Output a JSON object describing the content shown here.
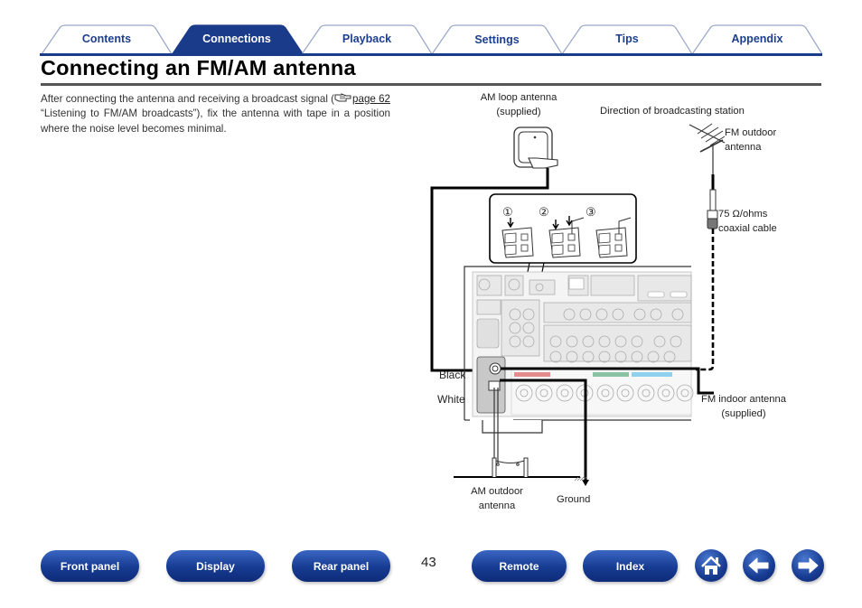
{
  "tabs": [
    {
      "label": "Contents",
      "active": false
    },
    {
      "label": "Connections",
      "active": true
    },
    {
      "label": "Playback",
      "active": false
    },
    {
      "label": "Settings",
      "active": false
    },
    {
      "label": "Tips",
      "active": false
    },
    {
      "label": "Appendix",
      "active": false
    }
  ],
  "page": {
    "title": "Connecting an FM/AM antenna",
    "body_before": "After connecting the antenna and receiving a broadcast signal (",
    "ref_icon": "pointing-hand-reference-icon",
    "ref_link": "page 62",
    "body_after": " “Listening to FM/AM broadcasts”), fix the antenna with tape in a position where the noise level becomes minimal.",
    "page_number": "43"
  },
  "diagram": {
    "am_loop_line1": "AM loop antenna",
    "am_loop_line2": "(supplied)",
    "direction": "Direction of broadcasting station",
    "fm_outdoor_line1": "FM outdoor",
    "fm_outdoor_line2": "antenna",
    "coax_line1": "75 Ω/ohms",
    "coax_line2": "coaxial cable",
    "step1": "①",
    "step2": "②",
    "step3": "③",
    "black": "Black",
    "white": "White",
    "fm_indoor_line1": "FM indoor antenna",
    "fm_indoor_line2": "(supplied)",
    "am_outdoor_line1": "AM outdoor",
    "am_outdoor_line2": "antenna",
    "ground": "Ground"
  },
  "nav": {
    "front_panel": "Front panel",
    "display": "Display",
    "rear_panel": "Rear panel",
    "remote": "Remote",
    "index": "Index",
    "home_icon": "home-icon",
    "back_icon": "arrow-left-icon",
    "forward_icon": "arrow-right-icon"
  },
  "colors": {
    "brand_blue": "#1a3a8a",
    "tab_text": "#1d3f8f",
    "front_speaker": "#e48b8b",
    "center_speaker": "#8cc2a4",
    "surround_speaker": "#8fd0ee"
  }
}
